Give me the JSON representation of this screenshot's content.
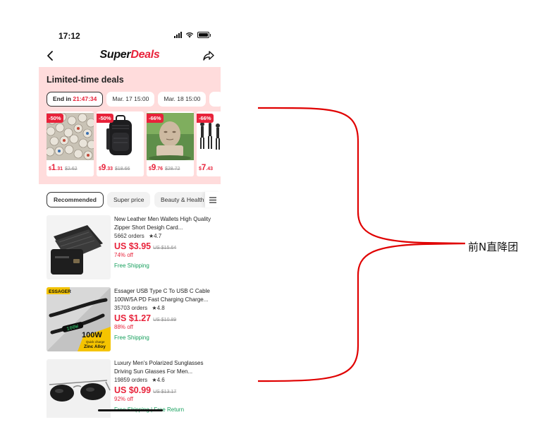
{
  "status_bar": {
    "time": "17:12"
  },
  "navbar": {
    "brand_part1": "Super",
    "brand_part2": "Deals"
  },
  "banner": {
    "title": "Limited-time deals",
    "slots": [
      {
        "label": "End in",
        "countdown": "21:47:34",
        "active": true
      },
      {
        "label": "Mar. 17 15:00",
        "active": false
      },
      {
        "label": "Mar. 18 15:00",
        "active": false
      }
    ],
    "deals": [
      {
        "badge": "-50%",
        "currency": "$",
        "price_main": "1",
        "price_cents": ".31",
        "old_price": "$2.62",
        "icon": "bottle-caps-image"
      },
      {
        "badge": "-50%",
        "currency": "$",
        "price_main": "9",
        "price_cents": ".33",
        "old_price": "$18.66",
        "icon": "backpack-image"
      },
      {
        "badge": "-66%",
        "currency": "$",
        "price_main": "9",
        "price_cents": ".76",
        "old_price": "$28.72",
        "icon": "planter-image"
      },
      {
        "badge": "-66%",
        "currency": "$",
        "price_main": "7",
        "price_cents": ".43",
        "old_price": "",
        "icon": "figures-image"
      }
    ]
  },
  "tabs": [
    {
      "label": "Recommended",
      "active": true
    },
    {
      "label": "Super price",
      "active": false
    },
    {
      "label": "Beauty & Health",
      "active": false
    }
  ],
  "products": [
    {
      "title": "New Leather Men Wallets High Quality Zipper Short Desigh Card...",
      "orders": "5662 orders",
      "rating": "4.7",
      "price": "US $3.95",
      "old_price": "US $15.64",
      "off": "74% off",
      "shipping": "Free Shipping",
      "icon": "wallet-image"
    },
    {
      "title": "Essager USB Type C To USB C Cable 100W/5A PD Fast Charging Charge...",
      "orders": "35703 orders",
      "rating": "4.8",
      "price": "US $1.27",
      "old_price": "US $10.89",
      "off": "88% off",
      "shipping": "Free Shipping",
      "icon": "usb-cable-image",
      "image_labels": {
        "brand": "ESSAGER",
        "watt": "100W",
        "sub": "Quick charge",
        "material": "Zinc Alloy"
      }
    },
    {
      "title": "Luxury Men's Polarized Sunglasses Driving Sun Glasses For Men...",
      "orders": "19859 orders",
      "rating": "4.6",
      "price": "US $0.99",
      "old_price": "US $13.17",
      "off": "92% off",
      "shipping": "Free Shipping",
      "extra": "Free Return",
      "icon": "sunglasses-image"
    }
  ],
  "annotation": {
    "text": "前N直降团"
  },
  "colors": {
    "accent": "#e8223a",
    "banner_bg": "#ffdcdc",
    "ship_green": "#17a05d",
    "bracket_red": "#e00000"
  }
}
